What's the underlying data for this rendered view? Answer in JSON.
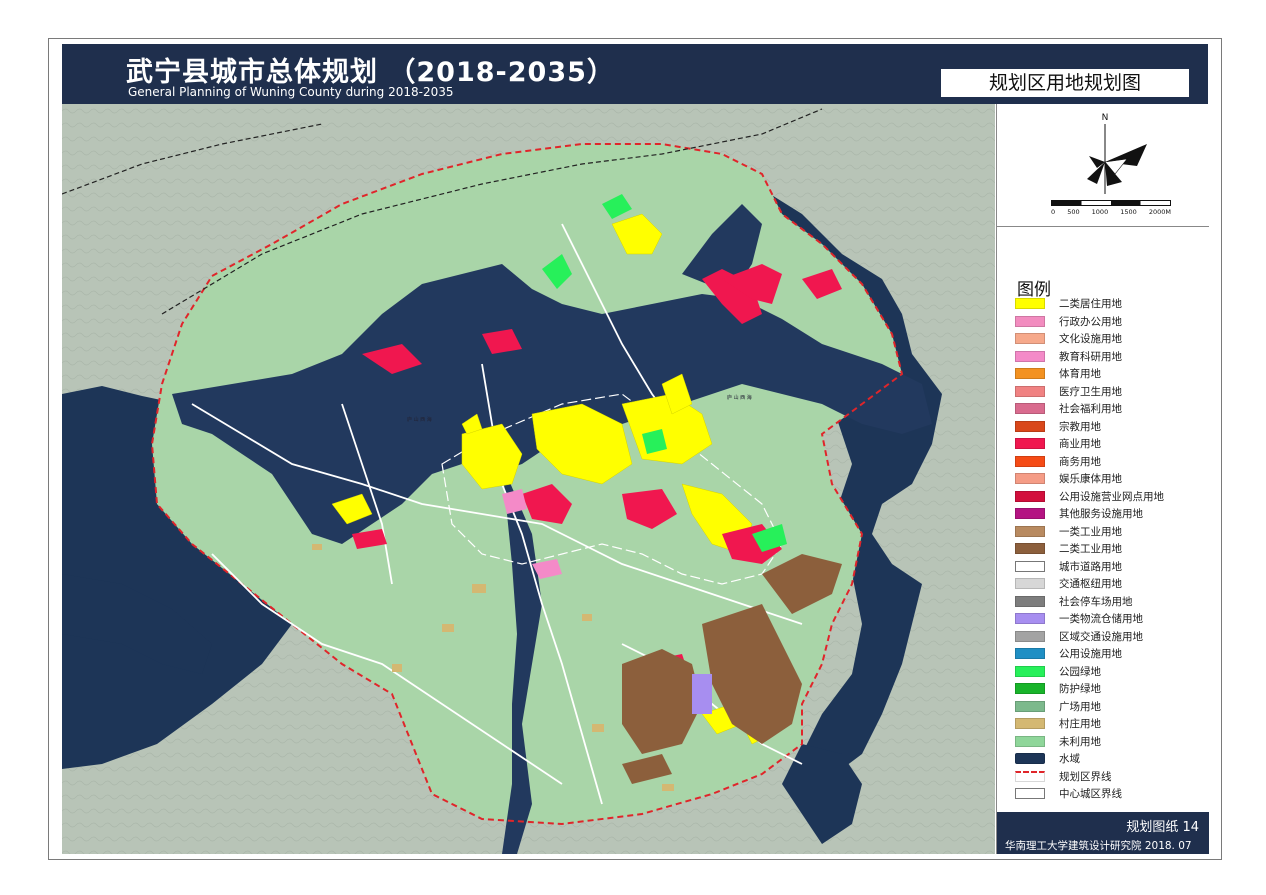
{
  "header": {
    "title_cn": "武宁县城市总体规划 （2018-2035）",
    "title_en": "General Planning  of Wuning County during 2018-2035",
    "map_title": "规划区用地规划图"
  },
  "compass": {
    "north_label": "N"
  },
  "scale_bar": {
    "labels": [
      "0",
      "500",
      "1000",
      "1500",
      "2000M"
    ]
  },
  "legend": {
    "title": "图例",
    "items": [
      {
        "label": "二类居住用地",
        "color": "#ffff00"
      },
      {
        "label": "行政办公用地",
        "color": "#f28cbf"
      },
      {
        "label": "文化设施用地",
        "color": "#f6a98b"
      },
      {
        "label": "教育科研用地",
        "color": "#f48ac8"
      },
      {
        "label": "体育用地",
        "color": "#f39221"
      },
      {
        "label": "医疗卫生用地",
        "color": "#f08282"
      },
      {
        "label": "社会福利用地",
        "color": "#d96b8e"
      },
      {
        "label": "宗教用地",
        "color": "#d9471a"
      },
      {
        "label": "商业用地",
        "color": "#f0174f"
      },
      {
        "label": "商务用地",
        "color": "#f54b16"
      },
      {
        "label": "娱乐康体用地",
        "color": "#f59c86"
      },
      {
        "label": "公用设施营业网点用地",
        "color": "#d20f3c"
      },
      {
        "label": "其他服务设施用地",
        "color": "#b41382"
      },
      {
        "label": "一类工业用地",
        "color": "#b88a60"
      },
      {
        "label": "二类工业用地",
        "color": "#8c5f3c"
      },
      {
        "label": "城市道路用地",
        "color": "#ffffff"
      },
      {
        "label": "交通枢纽用地",
        "color": "#d7d7d7"
      },
      {
        "label": "社会停车场用地",
        "color": "#7d7d7d"
      },
      {
        "label": "一类物流仓储用地",
        "color": "#a78ef0"
      },
      {
        "label": "区域交通设施用地",
        "color": "#a3a3a3"
      },
      {
        "label": "公用设施用地",
        "color": "#1f8fc4"
      },
      {
        "label": "公园绿地",
        "color": "#27f05a"
      },
      {
        "label": "防护绿地",
        "color": "#18b42a"
      },
      {
        "label": "广场用地",
        "color": "#7cb98c"
      },
      {
        "label": "村庄用地",
        "color": "#d4b872"
      },
      {
        "label": "未利用地",
        "color": "#8fd69a"
      },
      {
        "label": "水域",
        "color": "#1d3557"
      },
      {
        "label": "规划区界线",
        "color": "#e0252a"
      },
      {
        "label": "中心城区界线",
        "color": "#ffffff"
      }
    ]
  },
  "footer": {
    "sheet_number": "规划图纸  14",
    "institute": "华南理工大学建筑设计研究院  2018. 07"
  },
  "map_labels": {
    "lake_label_1": "庐 山 西 海",
    "lake_label_2": "庐 山 西 海"
  }
}
